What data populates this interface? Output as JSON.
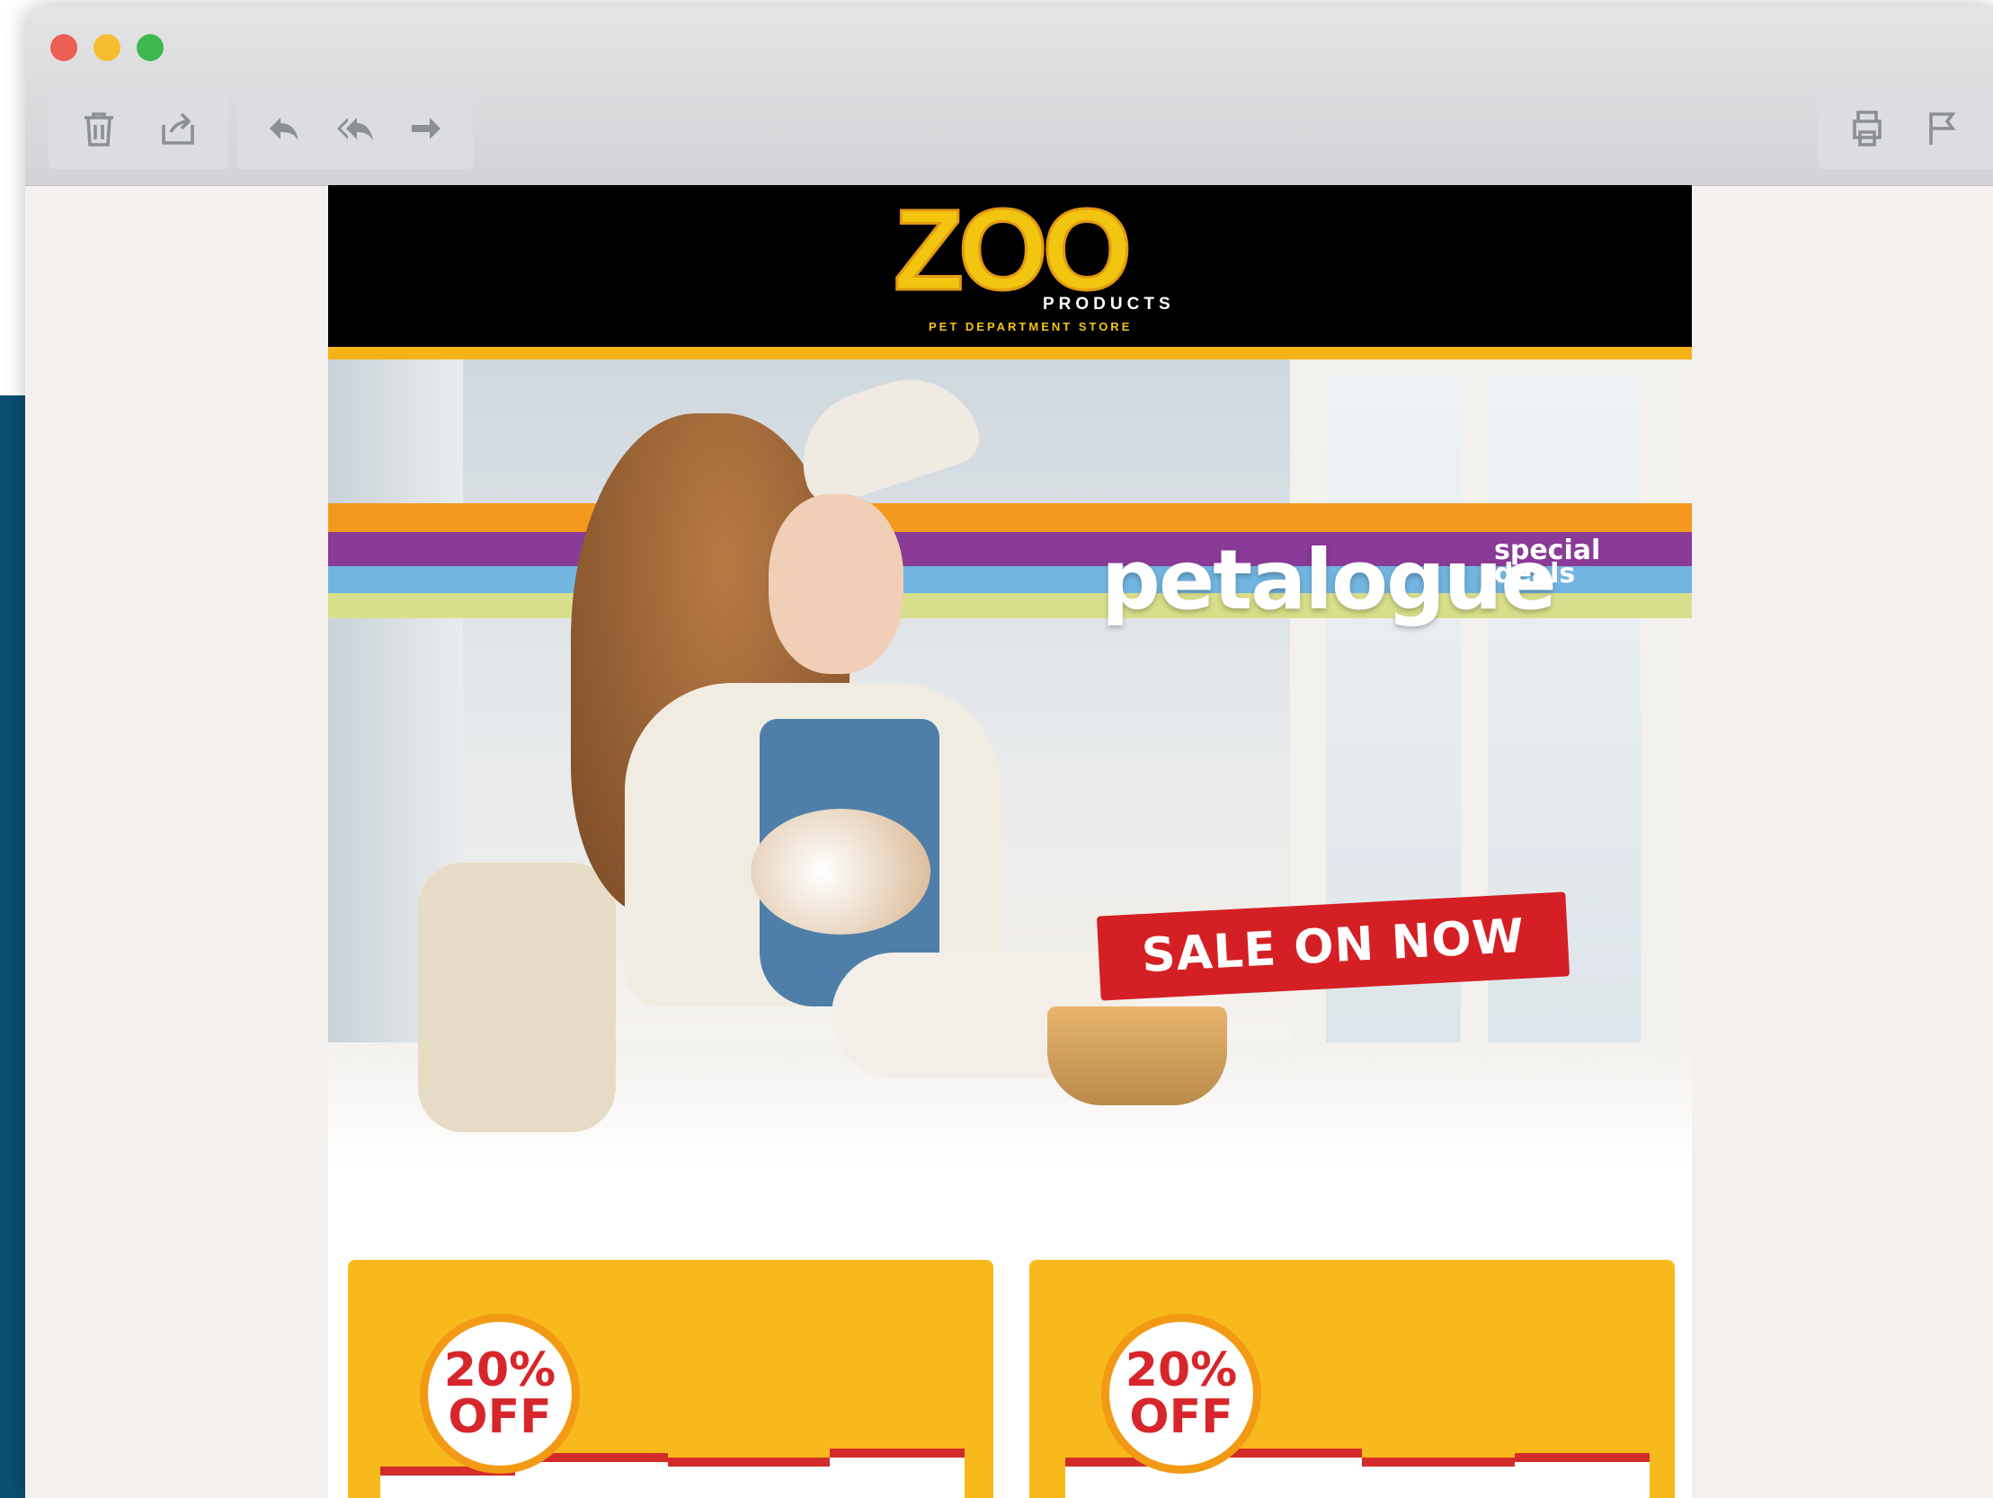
{
  "toolbar": {
    "left_actions": [
      {
        "id": "delete",
        "icon": "trash-icon"
      },
      {
        "id": "move",
        "icon": "move-to-icon"
      }
    ],
    "reply_actions": [
      {
        "id": "reply",
        "icon": "reply-icon"
      },
      {
        "id": "reply_all",
        "icon": "reply-all-icon"
      },
      {
        "id": "forward",
        "icon": "forward-icon"
      }
    ],
    "right_actions": [
      {
        "id": "print",
        "icon": "printer-icon"
      },
      {
        "id": "flag",
        "icon": "flag-icon"
      }
    ]
  },
  "email": {
    "brand": {
      "name": "ZOO",
      "subtitle": "PRODUCTS",
      "tagline": "PET DEPARTMENT STORE"
    },
    "hero": {
      "headline": "petalogue",
      "badge_line1": "special",
      "badge_line2": "deals",
      "cta": "SALE ON NOW"
    },
    "promos": [
      {
        "discount_line1": "20%",
        "discount_line2": "OFF"
      },
      {
        "discount_line1": "20%",
        "discount_line2": "OFF"
      }
    ]
  },
  "colors": {
    "traffic_red": "#ed5e54",
    "traffic_yellow": "#f5bd2f",
    "traffic_green": "#3fb850",
    "brand_yellow": "#f2c511",
    "sale_red": "#d42024",
    "promo_yellow": "#f8b91c",
    "stripe_orange": "#f39a1c",
    "stripe_purple": "#8a3a97",
    "stripe_blue": "#71b5e0",
    "stripe_lime": "#d8df8a"
  }
}
